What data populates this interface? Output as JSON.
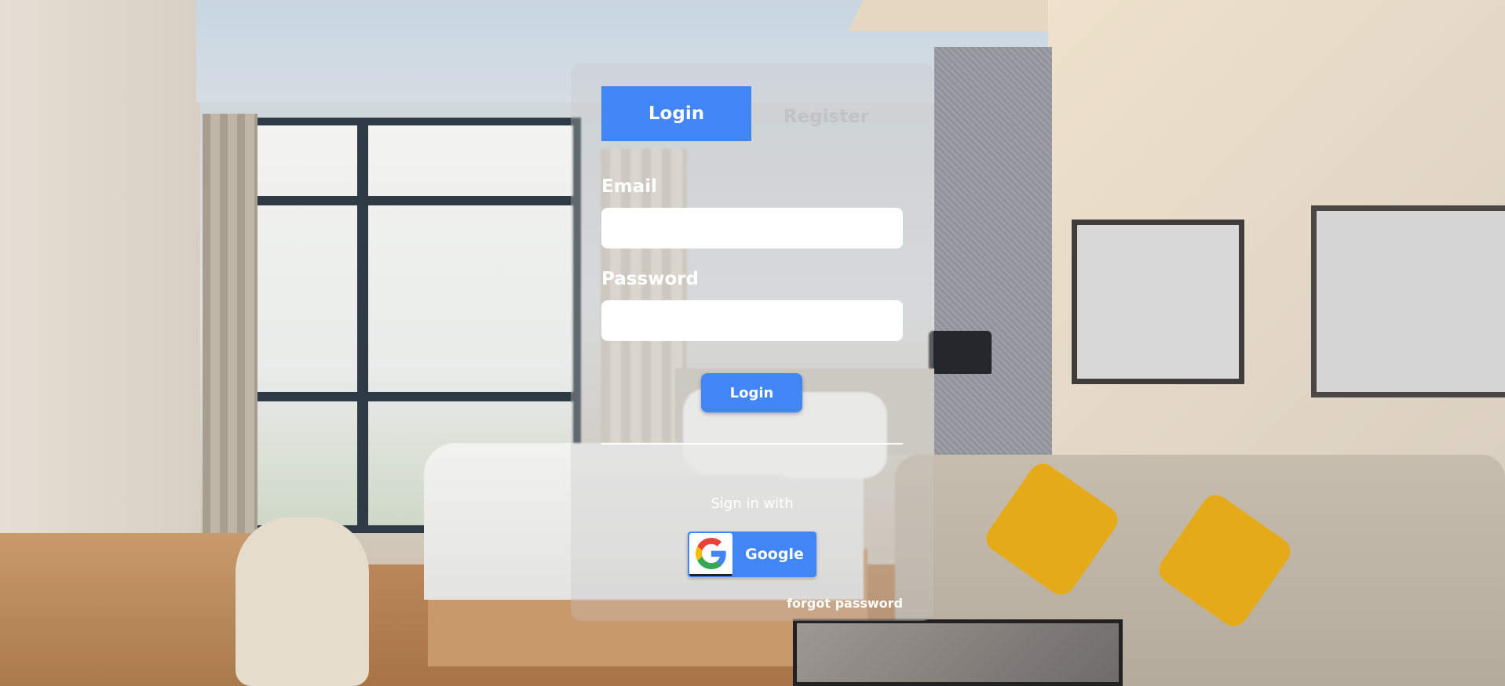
{
  "tabs": {
    "login_label": "Login",
    "register_label": "Register",
    "active": "login"
  },
  "form": {
    "email_label": "Email",
    "email_value": "",
    "password_label": "Password",
    "password_value": "",
    "submit_label": "Login"
  },
  "social": {
    "prompt": "Sign in with",
    "google_label": "Google",
    "google_icon": "google-g-icon"
  },
  "links": {
    "forgot_password": "forgot password"
  },
  "colors": {
    "accent": "#4285f4",
    "text_on_dark": "#ffffff",
    "inactive_tab": "#bfc3c6"
  }
}
